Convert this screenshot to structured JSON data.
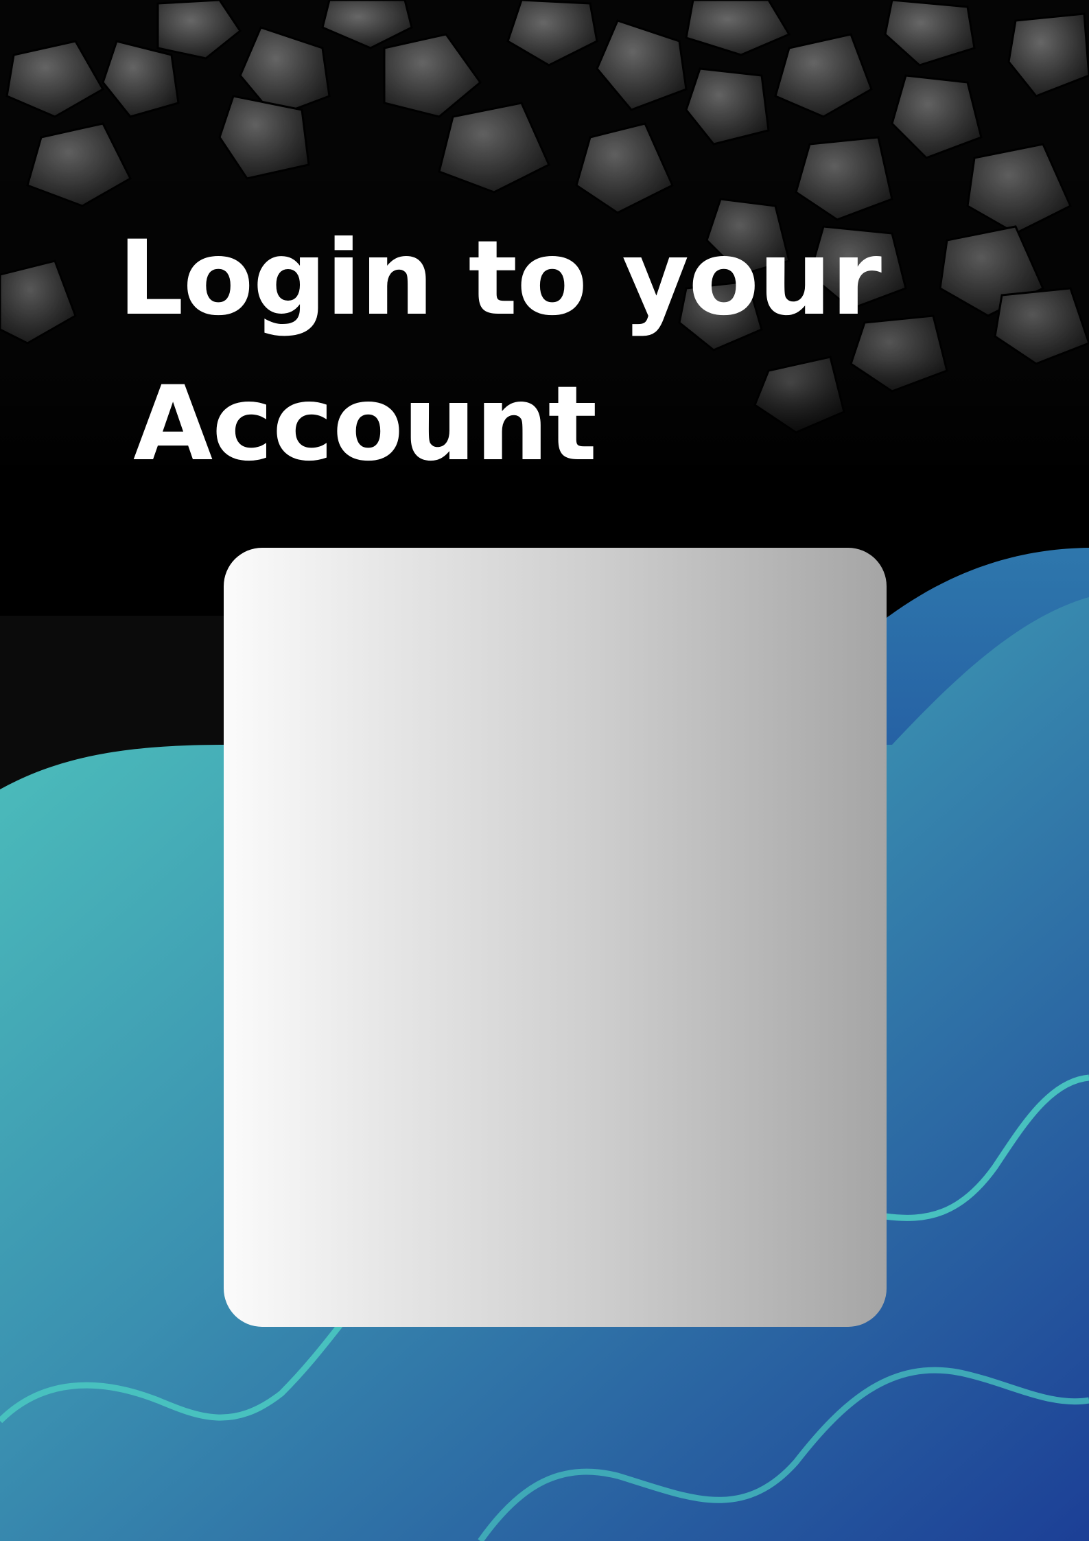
{
  "login": {
    "title_line1": "Login to your",
    "title_line2": "Account"
  },
  "colors": {
    "background": "#000000",
    "teal": "#4fc3bc",
    "blue": "#1f4b9c",
    "wave_line": "#4cc2c0",
    "card_light": "#fbfbfb",
    "card_dark": "#a5a5a5"
  }
}
